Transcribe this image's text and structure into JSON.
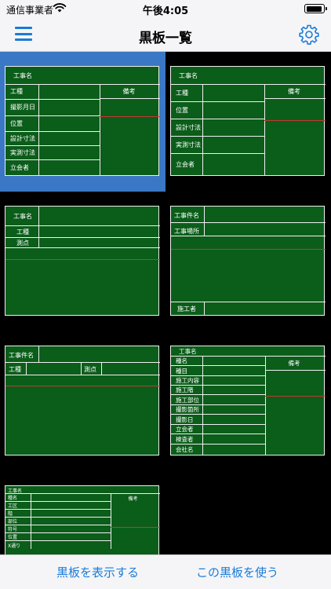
{
  "status_bar": {
    "carrier": "通信事業者",
    "time": "午後4:05",
    "battery_level": 0.95
  },
  "nav": {
    "title": "黒板一覧",
    "menu_icon": "hamburger-icon",
    "settings_icon": "gear-icon"
  },
  "colors": {
    "board": "#0b5d1a",
    "line": "#f0f0f0",
    "accent": "#1a7bd8",
    "selection": "#3a77c4"
  },
  "boards": [
    {
      "labels": [
        "工事名",
        "工種",
        "撮影月日",
        "位置",
        "設計寸法",
        "実測寸法",
        "立会者"
      ],
      "remarks": "備考",
      "selected": true
    },
    {
      "labels": [
        "工事名",
        "工種",
        "位置",
        "設計寸法",
        "実測寸法",
        "立会者"
      ],
      "remarks": "備考",
      "selected": false
    },
    {
      "labels": [
        "工事名",
        "工種",
        "測点"
      ],
      "selected": false
    },
    {
      "labels": [
        "工事件名",
        "工事場所",
        "施工者"
      ],
      "selected": false
    },
    {
      "labels": [
        "工事件名",
        "工種",
        "測点"
      ],
      "selected": false
    },
    {
      "labels": [
        "工事名",
        "種名",
        "種目",
        "施工内容",
        "施工階",
        "施工部位",
        "撮影箇所",
        "撮影日",
        "立会者",
        "検査者",
        "会社名"
      ],
      "remarks": "備考",
      "selected": false
    },
    {
      "labels": [
        "工事名",
        "種名",
        "工区",
        "階",
        "部位",
        "符号",
        "位置",
        "X通り"
      ],
      "remarks": "備考",
      "selected": false
    }
  ],
  "toolbar": {
    "show_label": "黒板を表示する",
    "use_label": "この黒板を使う"
  }
}
